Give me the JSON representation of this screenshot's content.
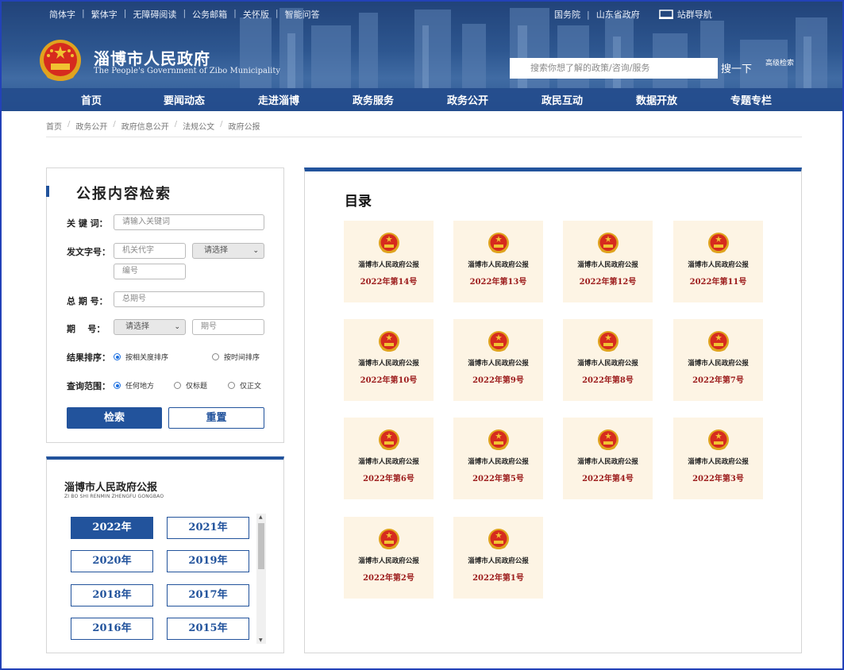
{
  "topbar": {
    "left_links": [
      "简体字",
      "繁体字",
      "无障碍阅读",
      "公务邮箱",
      "关怀版",
      "智能问答"
    ],
    "right_links": [
      "国务院",
      "山东省政府"
    ],
    "site_nav_label": "站群导航"
  },
  "header": {
    "site_name": "淄博市人民政府",
    "site_name_en": "The People's Government of Zibo Municipality",
    "search_placeholder": "搜索你想了解的政策/咨询/服务",
    "search_button": "搜一下",
    "advanced_search": "高级检索"
  },
  "nav": [
    "首页",
    "要闻动态",
    "走进淄博",
    "政务服务",
    "政务公开",
    "政民互动",
    "数据开放",
    "专题专栏"
  ],
  "breadcrumb": [
    "首页",
    "政务公开",
    "政府信息公开",
    "法规公文",
    "政府公报"
  ],
  "search_panel": {
    "title": "公报内容检索",
    "keyword_label": "关 键 词：",
    "keyword_placeholder": "请输入关键词",
    "doc_no_label": "发文字号：",
    "org_code_placeholder": "机关代字",
    "select_placeholder": "请选择",
    "number_placeholder": "编号",
    "total_issue_label": "总 期 号：",
    "total_issue_placeholder": "总期号",
    "issue_label": "期    号：",
    "issue_placeholder": "期号",
    "sort_label": "结果排序：",
    "sort_options": [
      "按相关度排序",
      "按时间排序"
    ],
    "scope_label": "查询范围：",
    "scope_options": [
      "任何地方",
      "仅标题",
      "仅正文"
    ],
    "search_button": "检索",
    "reset_button": "重置"
  },
  "archive": {
    "title": "淄博市人民政府公报",
    "subtitle": "ZI BO SHI RENMIN ZHENGFU GONGBAO",
    "years": [
      "2022年",
      "2021年",
      "2020年",
      "2019年",
      "2018年",
      "2017年",
      "2016年",
      "2015年"
    ],
    "selected_year": "2022年"
  },
  "catalog": {
    "title": "目录",
    "issues": [
      {
        "name": "淄博市人民政府公报",
        "issue": "2022年第14号"
      },
      {
        "name": "淄博市人民政府公报",
        "issue": "2022年第13号"
      },
      {
        "name": "淄博市人民政府公报",
        "issue": "2022年第12号"
      },
      {
        "name": "淄博市人民政府公报",
        "issue": "2022年第11号"
      },
      {
        "name": "淄博市人民政府公报",
        "issue": "2022年第10号"
      },
      {
        "name": "淄博市人民政府公报",
        "issue": "2022年第9号"
      },
      {
        "name": "淄博市人民政府公报",
        "issue": "2022年第8号"
      },
      {
        "name": "淄博市人民政府公报",
        "issue": "2022年第7号"
      },
      {
        "name": "淄博市人民政府公报",
        "issue": "2022年第6号"
      },
      {
        "name": "淄博市人民政府公报",
        "issue": "2022年第5号"
      },
      {
        "name": "淄博市人民政府公报",
        "issue": "2022年第4号"
      },
      {
        "name": "淄博市人民政府公报",
        "issue": "2022年第3号"
      },
      {
        "name": "淄博市人民政府公报",
        "issue": "2022年第2号"
      },
      {
        "name": "淄博市人民政府公报",
        "issue": "2022年第1号"
      }
    ]
  },
  "colors": {
    "primary": "#22539c",
    "card_bg": "#fdf4e4",
    "issue_red": "#9c1c1c"
  },
  "icons": {
    "emblem": "national-emblem-icon",
    "monitor": "monitor-icon",
    "search": "search-icon"
  }
}
